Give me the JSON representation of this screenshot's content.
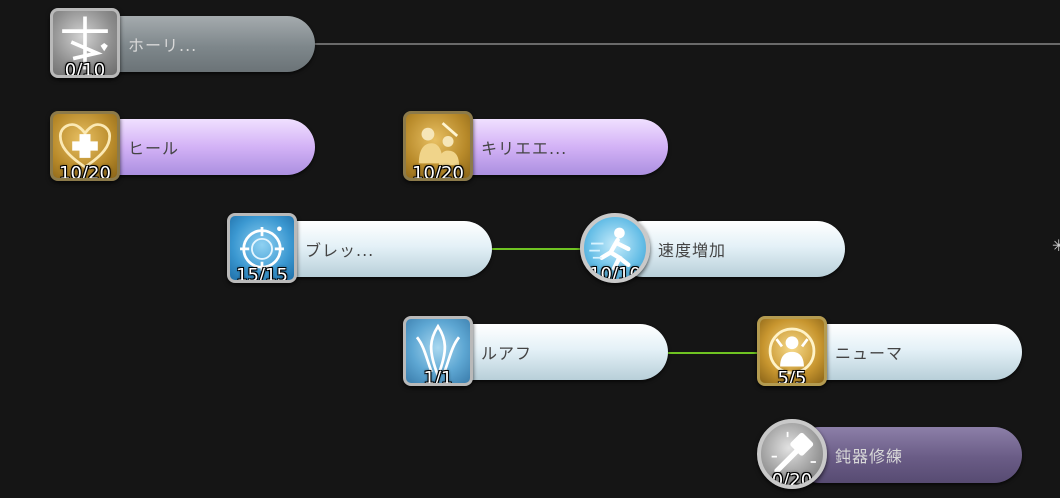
{
  "skills": [
    {
      "id": "holy",
      "label": "ホーリ...",
      "level": "0/10",
      "style": "gray",
      "icon": "holy-cross-icon"
    },
    {
      "id": "heal",
      "label": "ヒール",
      "level": "10/20",
      "style": "purple",
      "icon": "heart-cross-icon"
    },
    {
      "id": "kyrie",
      "label": "キリエエ...",
      "level": "10/20",
      "style": "purple",
      "icon": "kneeling-figures-icon"
    },
    {
      "id": "blessing",
      "label": "ブレッ...",
      "level": "15/15",
      "style": "light",
      "icon": "radiant-circle-icon"
    },
    {
      "id": "speed",
      "label": "速度増加",
      "level": "10/10",
      "style": "light",
      "icon": "running-figure-icon"
    },
    {
      "id": "ruwach",
      "label": "ルアフ",
      "level": "1/1",
      "style": "light",
      "icon": "wing-flame-icon"
    },
    {
      "id": "pneuma",
      "label": "ニューマ",
      "level": "5/5",
      "style": "light",
      "icon": "shielded-figure-icon"
    },
    {
      "id": "mace",
      "label": "鈍器修練",
      "level": "0/20",
      "style": "dark",
      "icon": "mace-icon"
    }
  ],
  "colors": {
    "background": "#151515",
    "connector_active": "#6fc322",
    "connector_inactive": "#6a6a6a"
  }
}
